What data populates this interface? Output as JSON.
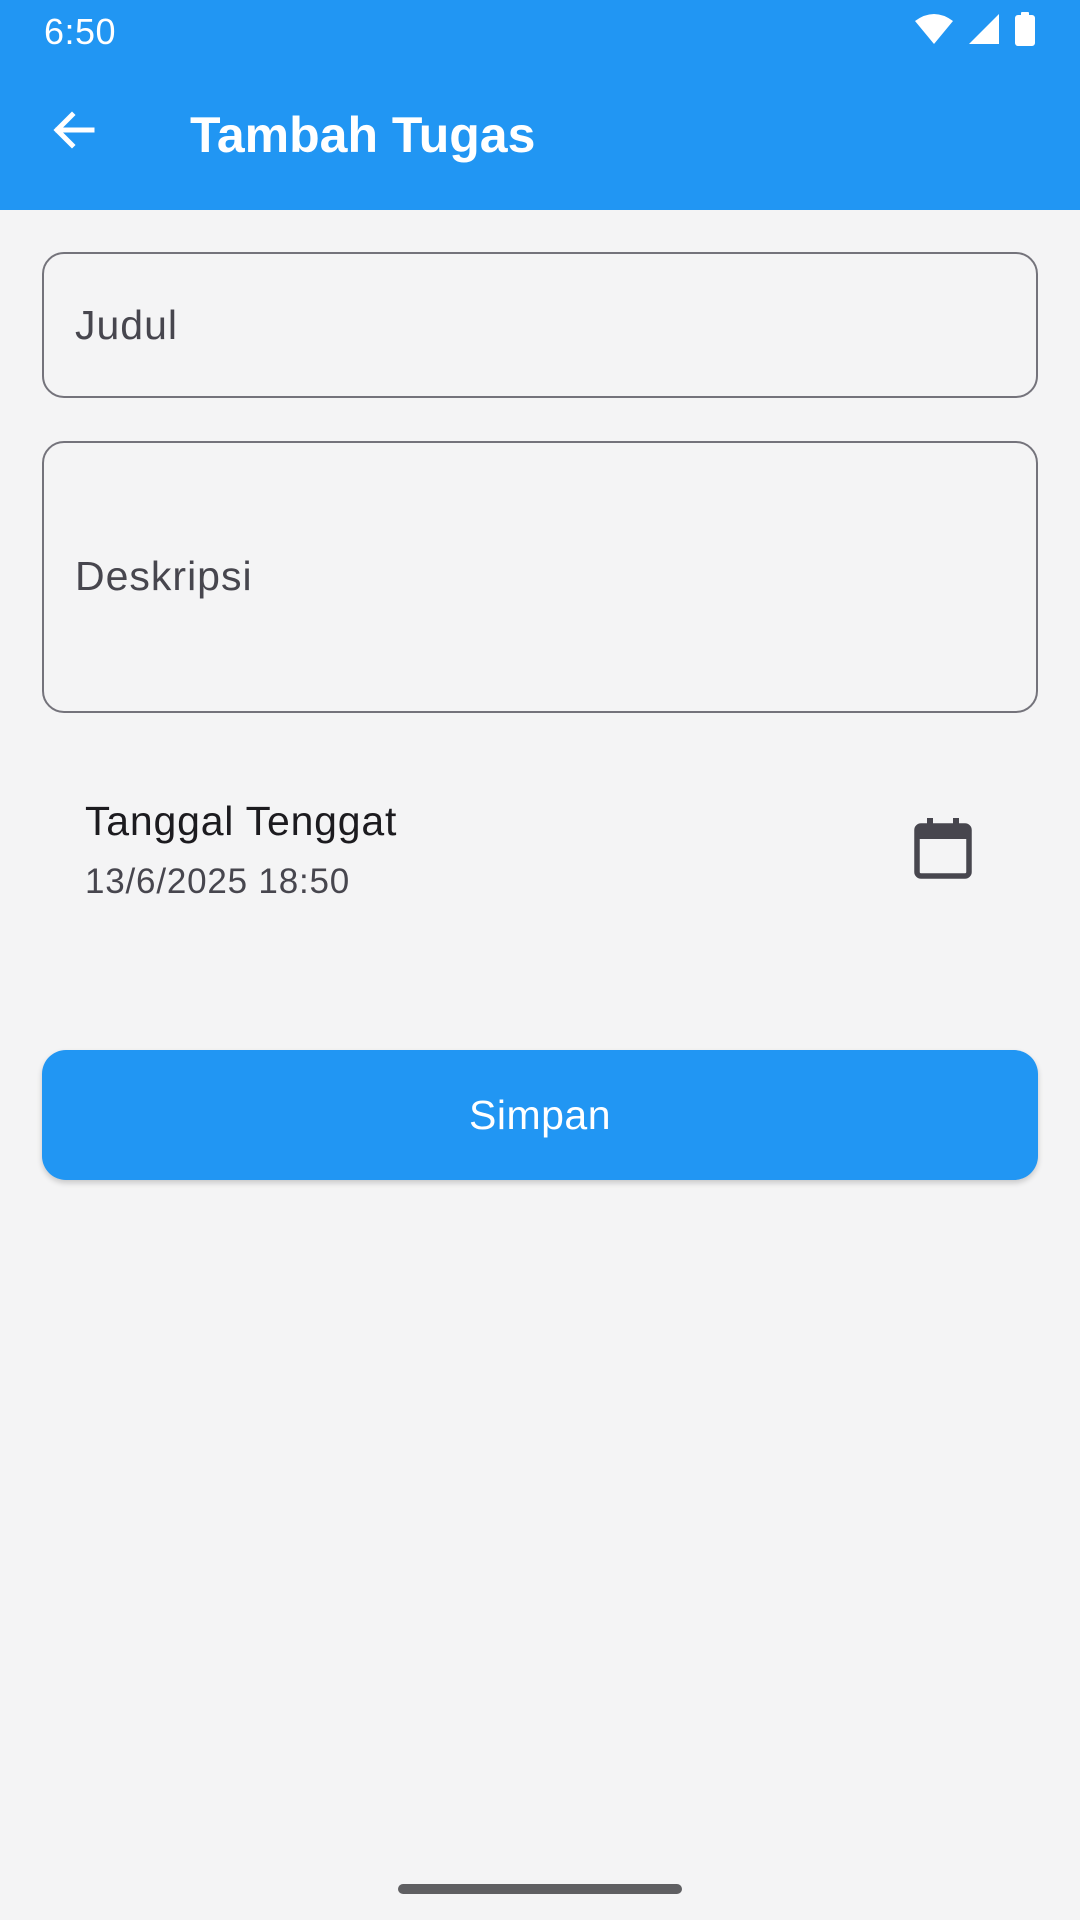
{
  "status_bar": {
    "time": "6:50",
    "icons": [
      "wifi-icon",
      "cellular-signal-icon",
      "battery-icon"
    ]
  },
  "app_bar": {
    "title": "Tambah Tugas",
    "back_icon": "arrow-back-icon"
  },
  "form": {
    "title_field": {
      "label": "Judul",
      "value": ""
    },
    "description_field": {
      "label": "Deskripsi",
      "value": ""
    },
    "due_date": {
      "label": "Tanggal Tenggat",
      "value": "13/6/2025 18:50",
      "icon": "calendar-icon"
    },
    "save_label": "Simpan"
  },
  "colors": {
    "primary": "#2196f3",
    "background": "#f4f4f5",
    "outline": "#74737b",
    "text_primary": "#1c1b1f",
    "text_secondary": "#47464e"
  }
}
